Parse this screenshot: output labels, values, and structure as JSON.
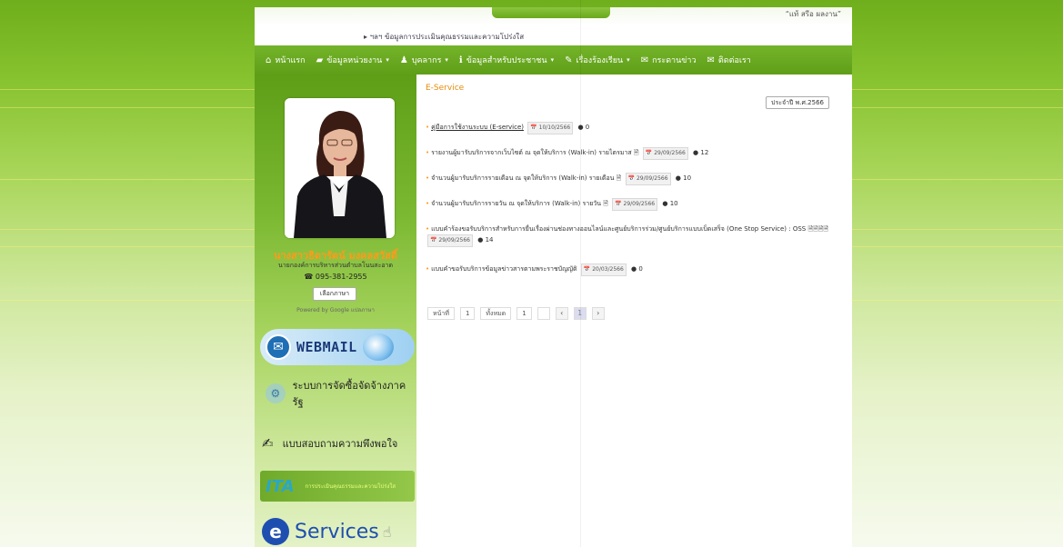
{
  "top": {
    "right_note": "“แท้ สรีอ ผลงาน”",
    "marquee": "ฯลฯ ข้อมูลการประเมินคุณธรรมและความโปร่งใส"
  },
  "nav": {
    "items": [
      {
        "icon": "home-icon",
        "glyph": "⌂",
        "label": "หน้าแรก",
        "caret": false
      },
      {
        "icon": "folder-icon",
        "glyph": "▰",
        "label": "ข้อมูลหน่วยงาน",
        "caret": true
      },
      {
        "icon": "user-icon",
        "glyph": "♟",
        "label": "บุคลากร",
        "caret": true
      },
      {
        "icon": "info-icon",
        "glyph": "ℹ",
        "label": "ข้อมูลสำหรับประชาชน",
        "caret": true
      },
      {
        "icon": "edit-icon",
        "glyph": "✎",
        "label": "เรื่องร้องเรียน",
        "caret": true
      },
      {
        "icon": "chat-icon",
        "glyph": "✉",
        "label": "กระดานข่าว",
        "caret": false
      },
      {
        "icon": "mail-icon",
        "glyph": "✉",
        "label": "ติดต่อเรา",
        "caret": false
      }
    ]
  },
  "sidebar": {
    "name": "นางสาวธิดารัตน์ มงคลสวัสดิ์",
    "title": "นายกองค์การบริหารส่วนตำบลโนนสะอาด",
    "phone": "☎ 095-381-2955",
    "lang_button": "เลือกภาษา",
    "lang_sub": "Powered by Google แปลภาษา",
    "webmail": "WEBMAIL",
    "procurement": "ระบบการจัดซื้อจัดจ้างภาครัฐ",
    "survey": "แบบสอบถามความพึงพอใจ",
    "ita": "ITA",
    "ita_sub": "การประเมินคุณธรรมและความโปร่งใส",
    "eservices": "Services"
  },
  "content": {
    "section_title": "E-Service",
    "year_button": "ประจำปี พ.ศ.2566",
    "docs": [
      {
        "text": "คู่มือการใช้งานระบบ (E-service)",
        "link": true,
        "date": "10/10/2566",
        "views": "0"
      },
      {
        "text": "รายงานผู้มารับบริการจากเว็บไซต์ ณ จุดให้บริการ (Walk-in) รายไตรมาส",
        "link": false,
        "date": "29/09/2566",
        "views": "12"
      },
      {
        "text": "จำนวนผู้มารับบริการรายเดือน ณ จุดให้บริการ (Walk-in) รายเดือน",
        "link": false,
        "date": "29/09/2566",
        "views": "10"
      },
      {
        "text": "จำนวนผู้มารับบริการรายวัน ณ จุดให้บริการ (Walk-in) รายวัน",
        "link": false,
        "date": "29/09/2566",
        "views": "10"
      },
      {
        "text": "แบบคำร้องขอรับบริการสำหรับการยื่นเรื่องผ่านช่องทางออนไลน์และศูนย์บริการร่วม/ศูนย์บริการแบบเบ็ดเสร็จ (One Stop Service) : OSS",
        "link": false,
        "date": "29/09/2566",
        "views": "14"
      },
      {
        "text": "แบบคำขอรับบริการข้อมูลข่าวสารตามพระราชบัญญัติ",
        "link": false,
        "date": "20/03/2566",
        "views": "0"
      }
    ],
    "pager": {
      "page_label": "หน้าที่",
      "page_value": "1",
      "total_label": "ทั้งหมด",
      "total_value": "1",
      "prev": "‹",
      "current": "1",
      "next": "›"
    }
  }
}
